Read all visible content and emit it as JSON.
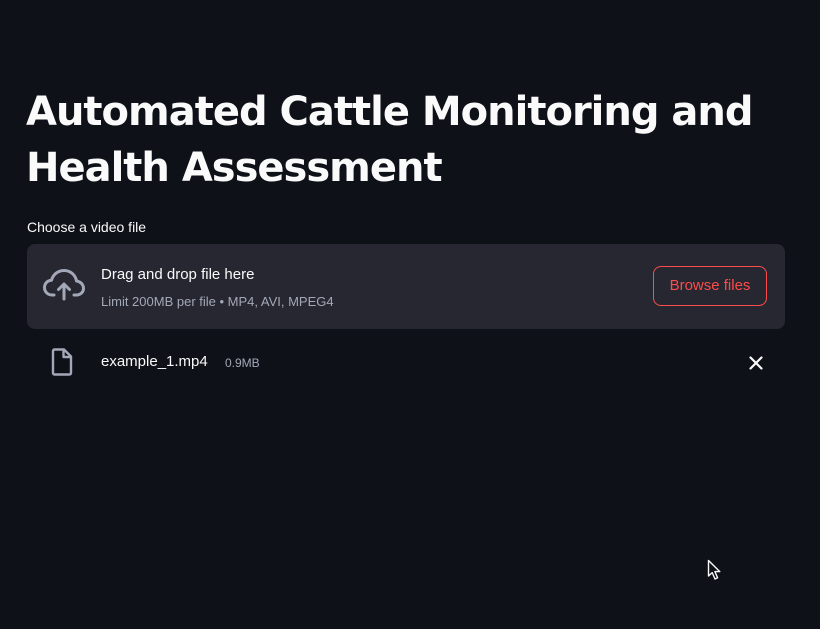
{
  "page": {
    "title": "Automated Cattle Monitoring and Health Assessment"
  },
  "uploader": {
    "label": "Choose a video file",
    "drop_title": "Drag and drop file here",
    "limit_text": "Limit 200MB per file • MP4, AVI, MPEG4",
    "browse_label": "Browse files",
    "icon": "cloud-upload-icon"
  },
  "uploaded_file": {
    "name": "example_1.mp4",
    "size": "0.9MB",
    "icon": "file-icon",
    "remove_icon": "close-icon"
  },
  "colors": {
    "background": "#0e1117",
    "dropzone": "#262730",
    "accent": "#ff4b4b",
    "text": "#fafafa",
    "muted_text": "#a3a8b8"
  }
}
